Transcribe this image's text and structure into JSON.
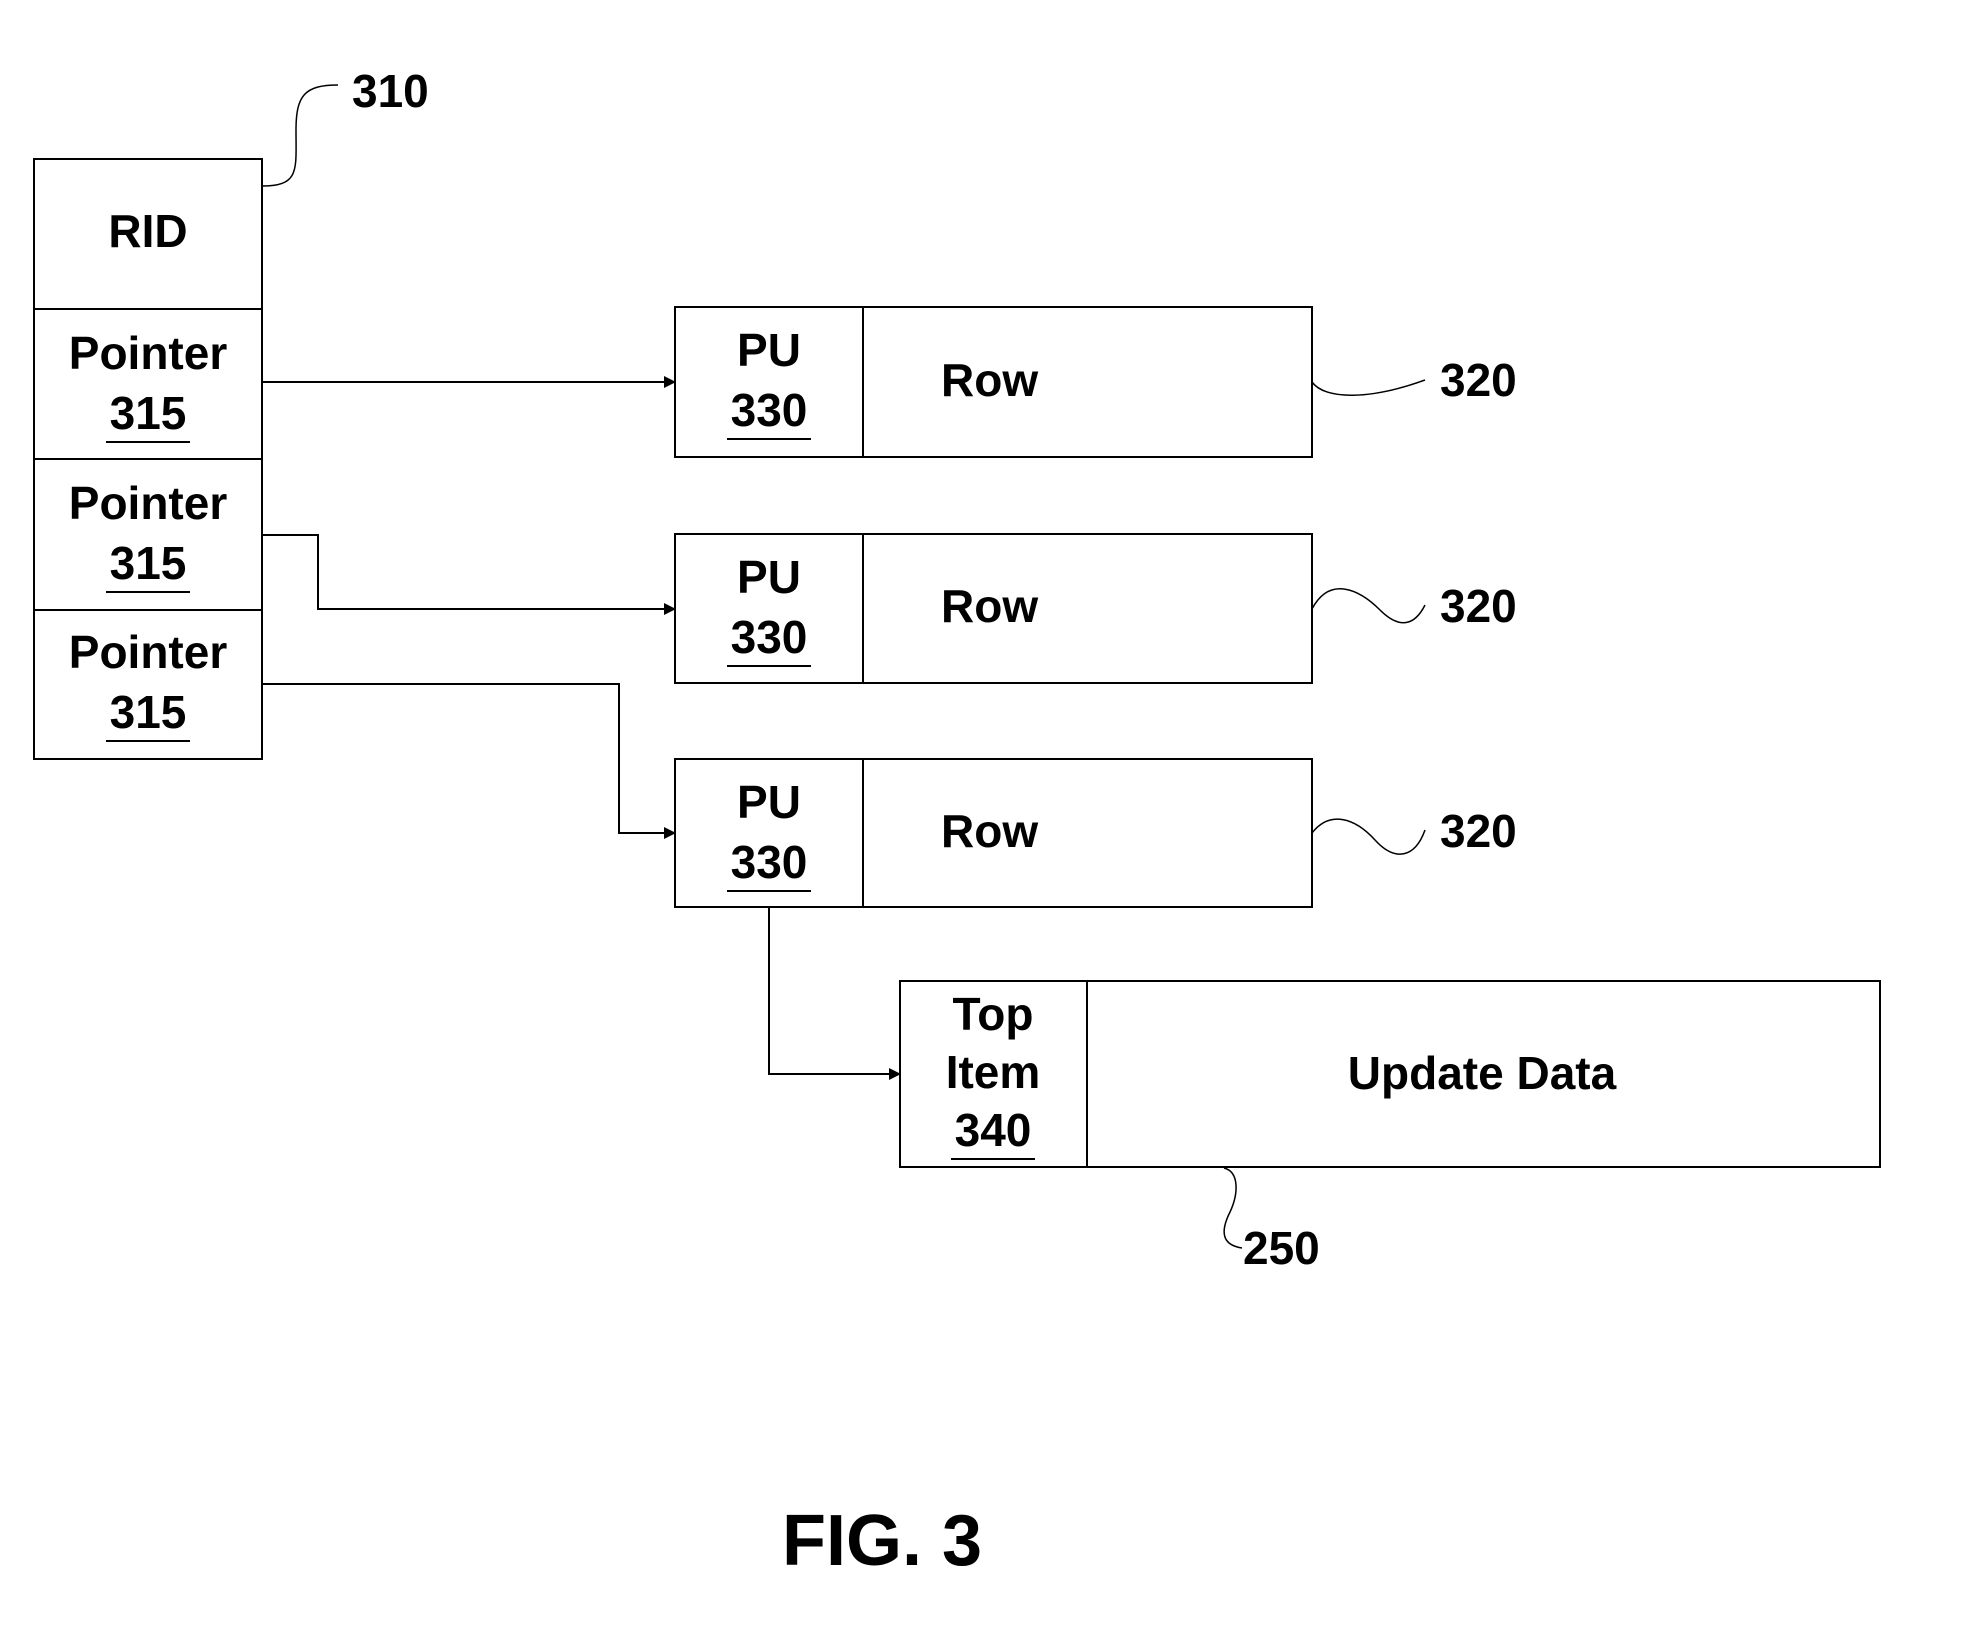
{
  "figure": {
    "caption": "FIG. 3",
    "rid_structure": {
      "ref": "310",
      "header": "RID",
      "pointers": [
        {
          "label": "Pointer",
          "ref": "315"
        },
        {
          "label": "Pointer",
          "ref": "315"
        },
        {
          "label": "Pointer",
          "ref": "315"
        }
      ]
    },
    "rows": [
      {
        "pu_label": "PU",
        "pu_ref": "330",
        "row_label": "Row",
        "ref": "320"
      },
      {
        "pu_label": "PU",
        "pu_ref": "330",
        "row_label": "Row",
        "ref": "320"
      },
      {
        "pu_label": "PU",
        "pu_ref": "330",
        "row_label": "Row",
        "ref": "320"
      }
    ],
    "update_item": {
      "top_line1": "Top",
      "top_line2": "Item",
      "top_ref": "340",
      "data_label": "Update Data",
      "ref": "250"
    }
  }
}
